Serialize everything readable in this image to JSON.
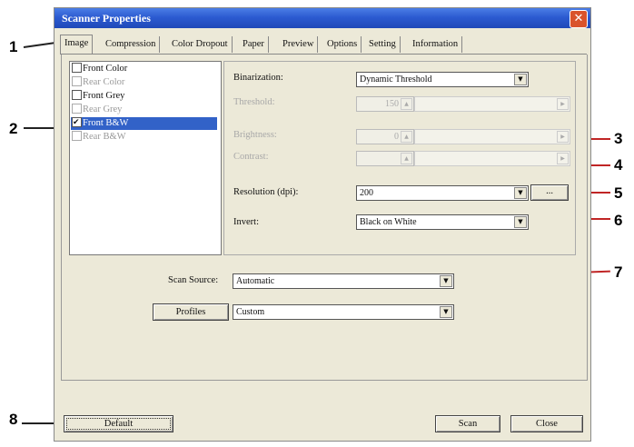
{
  "window": {
    "title": "Scanner Properties",
    "close_glyph": "✕"
  },
  "tabs": [
    "Image",
    "Compression",
    "Color Dropout",
    "Paper",
    "Preview",
    "Options",
    "Setting",
    "Information"
  ],
  "image_list": [
    {
      "label": "Front Color",
      "checked": false,
      "enabled": true
    },
    {
      "label": "Rear Color",
      "checked": false,
      "enabled": false
    },
    {
      "label": "Front Grey",
      "checked": false,
      "enabled": true
    },
    {
      "label": "Rear Grey",
      "checked": false,
      "enabled": false
    },
    {
      "label": "Front B&W",
      "checked": true,
      "enabled": true,
      "selected": true
    },
    {
      "label": "Rear B&W",
      "checked": false,
      "enabled": false
    }
  ],
  "binarization": {
    "label": "Binarization:",
    "value": "Dynamic Threshold"
  },
  "threshold": {
    "label": "Threshold:",
    "value": "150"
  },
  "brightness": {
    "label": "Brightness:",
    "value": "0"
  },
  "contrast": {
    "label": "Contrast:"
  },
  "resolution": {
    "label": "Resolution (dpi):",
    "value": "200",
    "more_label": "..."
  },
  "invert": {
    "label": "Invert:",
    "value": "Black on White"
  },
  "scan_source": {
    "label": "Scan Source:",
    "value": "Automatic"
  },
  "profiles": {
    "button_label": "Profiles",
    "value": "Custom"
  },
  "buttons": {
    "defaults": "Default",
    "scan": "Scan",
    "close": "Close"
  },
  "callouts": [
    "1",
    "2",
    "3",
    "4",
    "5",
    "6",
    "7",
    "8"
  ],
  "colors": {
    "titlebar": "#2c5bd1",
    "selection": "#3262c8",
    "callout_line": "#c02525"
  }
}
